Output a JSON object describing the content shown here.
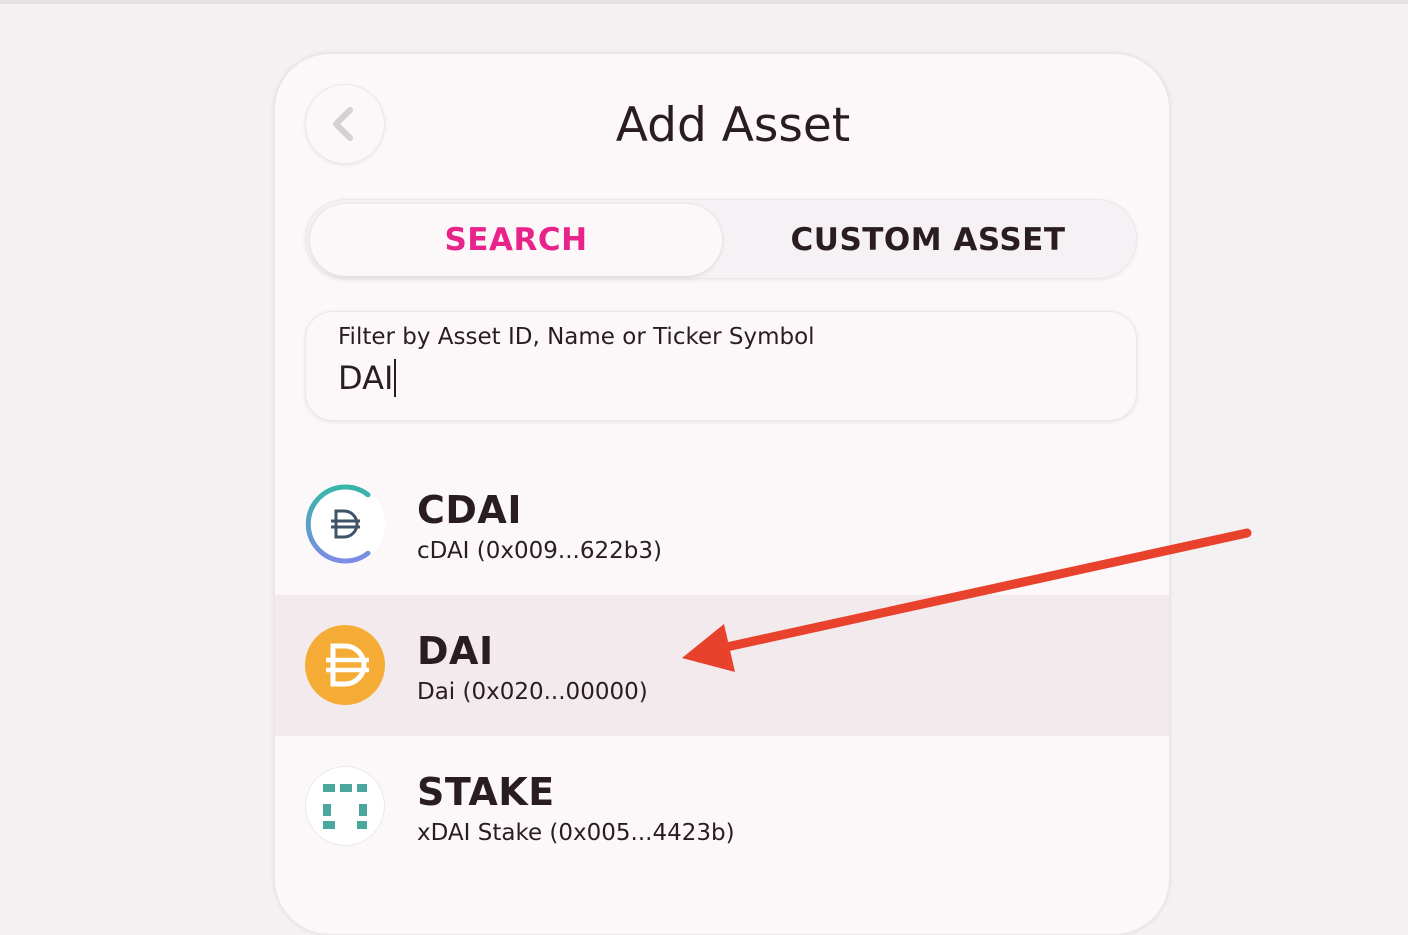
{
  "header": {
    "title": "Add Asset",
    "back_icon": "chevron-left-icon"
  },
  "tabs": [
    {
      "label": "SEARCH",
      "active": true
    },
    {
      "label": "CUSTOM ASSET",
      "active": false
    }
  ],
  "search": {
    "label": "Filter by Asset ID, Name or Ticker Symbol",
    "value": "DAI"
  },
  "assets": [
    {
      "symbol": "CDAI",
      "name": "cDAI (0x009...622b3)",
      "icon": "cdai-logo-icon",
      "selected": false
    },
    {
      "symbol": "DAI",
      "name": "Dai (0x020...00000)",
      "icon": "dai-logo-icon",
      "selected": true
    },
    {
      "symbol": "STAKE",
      "name": "xDAI Stake (0x005...4423b)",
      "icon": "stake-logo-icon",
      "selected": false
    }
  ],
  "colors": {
    "accent": "#e8238a",
    "text": "#2a1d22",
    "panel": "#fcf8fa",
    "selected_row": "#f2eaed",
    "annotation_arrow": "#e8412c",
    "dai_gold": "#f5ac37",
    "stake_teal": "#4aa79d"
  },
  "annotation": {
    "type": "arrow",
    "points_to": "DAI"
  }
}
